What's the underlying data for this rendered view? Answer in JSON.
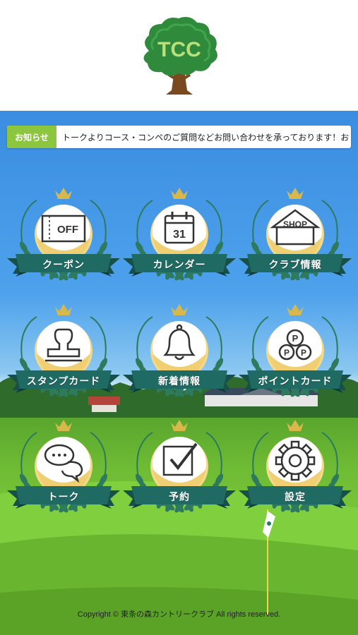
{
  "header": {
    "logo_text": "TCC"
  },
  "news": {
    "badge": "お知らせ",
    "text": "トークよりコース・コンペのご質問などお問い合わせを承っております！お"
  },
  "menu": [
    {
      "label": "クーポン",
      "icon": "coupon-off-icon",
      "icon_text": "OFF"
    },
    {
      "label": "カレンダー",
      "icon": "calendar-icon",
      "icon_text": "31"
    },
    {
      "label": "クラブ情報",
      "icon": "shop-icon",
      "icon_text": "SHOP"
    },
    {
      "label": "スタンプカード",
      "icon": "stamp-icon",
      "icon_text": ""
    },
    {
      "label": "新着情報",
      "icon": "bell-icon",
      "icon_text": ""
    },
    {
      "label": "ポイントカード",
      "icon": "points-icon",
      "icon_text": "P"
    },
    {
      "label": "トーク",
      "icon": "chat-icon",
      "icon_text": ""
    },
    {
      "label": "予約",
      "icon": "check-icon",
      "icon_text": ""
    },
    {
      "label": "設定",
      "icon": "gear-icon",
      "icon_text": ""
    }
  ],
  "footer": {
    "copyright": "Copyright © 東条の森カントリークラブ All rights reserved."
  },
  "colors": {
    "ribbon": "#1f6b63",
    "laurel": "#2e7a5e",
    "crown": "#d8b84a",
    "badge": "#8cc63f",
    "tree": "#3b9a3a"
  }
}
